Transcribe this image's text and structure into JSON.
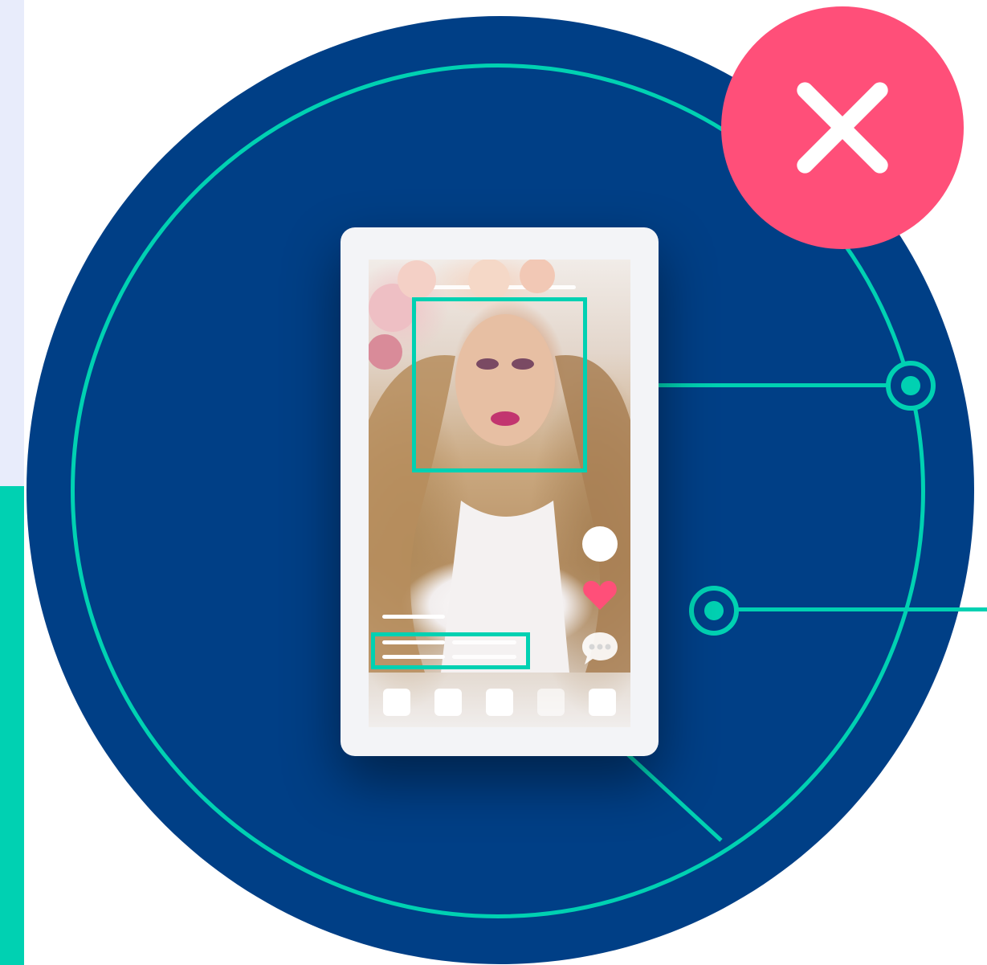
{
  "colors": {
    "background": "#ffffff",
    "panel_light": "#e8ecfb",
    "accent": "#00d1b2",
    "circle": "#003f86",
    "close_badge": "#ff4f79",
    "heart": "#ff4f79",
    "device": "#f3f4f7"
  },
  "icons": {
    "close": "close-icon",
    "heart": "heart-icon",
    "comment": "comment-bubble-icon",
    "avatar": "avatar-placeholder"
  },
  "phone": {
    "nav_button_count": 5
  }
}
